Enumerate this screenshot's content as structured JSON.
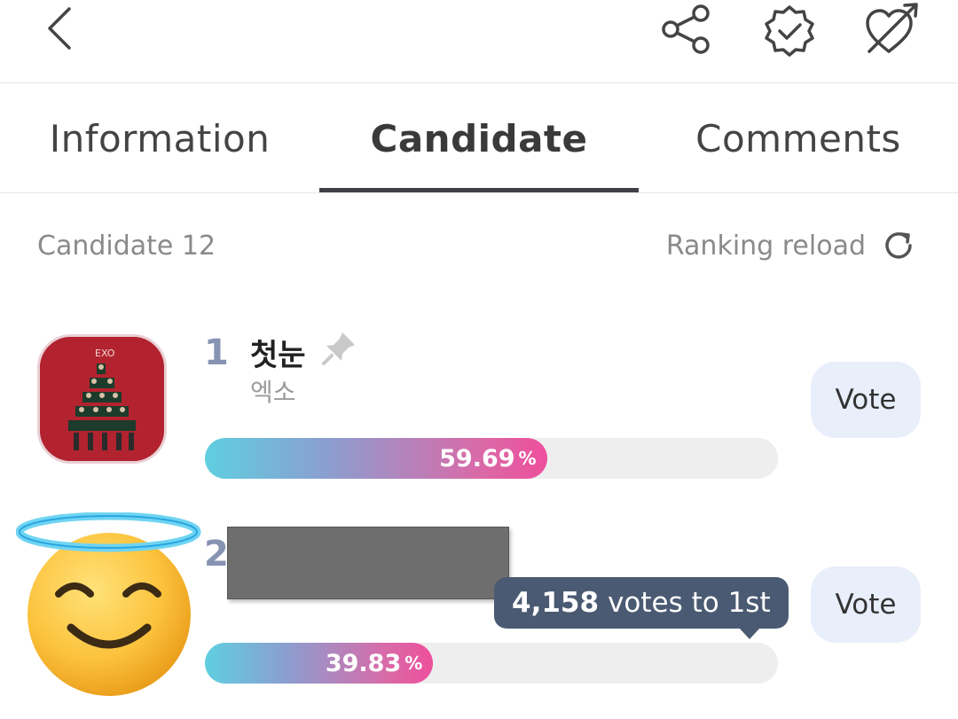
{
  "header": {
    "back_icon": "back-chevron-icon",
    "share_icon": "share-icon",
    "badge_icon": "verified-badge-icon",
    "heart_icon": "heart-arrow-icon"
  },
  "tabs": [
    {
      "label": "Information",
      "active": false
    },
    {
      "label": "Candidate",
      "active": true
    },
    {
      "label": "Comments",
      "active": false
    }
  ],
  "list": {
    "count_label": "Candidate 12",
    "reload_label": "Ranking reload"
  },
  "candidates": [
    {
      "rank": "1",
      "title": "첫눈",
      "artist": "엑소",
      "percent_value": "59.69",
      "percent_sign": "%",
      "fill_fraction": 0.5969,
      "vote_label": "Vote"
    },
    {
      "rank": "2",
      "percent_value": "39.83",
      "percent_sign": "%",
      "fill_fraction": 0.3983,
      "vote_label": "Vote",
      "gap_votes": "4,158",
      "gap_text": "votes to 1st"
    }
  ],
  "colors": {
    "accent_pink": "#ee4f9d",
    "accent_cyan": "#5fcfe0",
    "rank_color": "#8793b3",
    "vote_bg": "#e8eefa",
    "tooltip_bg": "#4a5a72"
  }
}
